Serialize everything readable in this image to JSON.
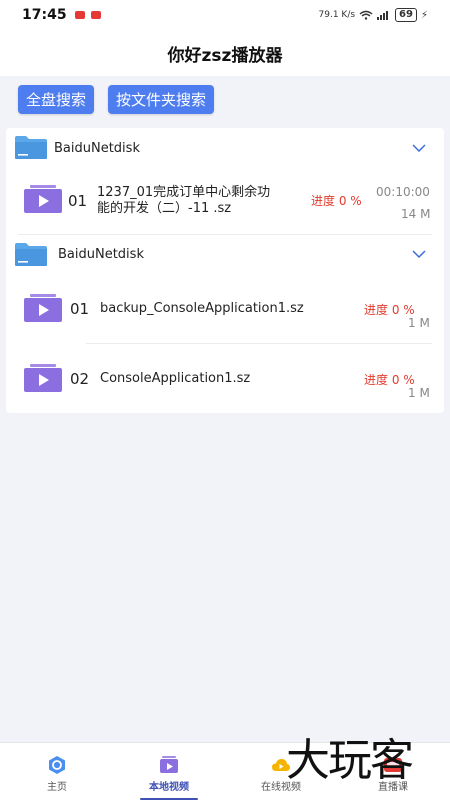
{
  "status_bar": {
    "time": "17:45",
    "network_speed": "79.1 K/s",
    "battery": "69"
  },
  "header": {
    "title": "你好zsz播放器"
  },
  "actions": {
    "search_all_label": "全盘搜索",
    "search_by_folder_label": "按文件夹搜索"
  },
  "groups": [
    {
      "name": "BaiduNetdisk",
      "files": [
        {
          "index": "01",
          "name_line1": "1237_01完成订单中心剩余功",
          "name_line2": "能的开发（二）-11 .sz",
          "progress": "进度 0 %",
          "progress_value": 0,
          "duration": "00:10:00",
          "size": "14 M"
        }
      ]
    },
    {
      "name": "BaiduNetdisk",
      "files": [
        {
          "index": "01",
          "name": "backup_ConsoleApplication1.sz",
          "progress": "进度 0 %",
          "progress_value": 0,
          "size": "1 M"
        },
        {
          "index": "02",
          "name": "ConsoleApplication1.sz",
          "progress": "进度 0 %",
          "progress_value": 0,
          "size": "1 M"
        }
      ]
    }
  ],
  "tabs": [
    {
      "label": "主页",
      "icon": "home-icon"
    },
    {
      "label": "本地视频",
      "icon": "local-video-icon",
      "active": true
    },
    {
      "label": "在线视频",
      "icon": "cloud-video-icon"
    },
    {
      "label": "直播课",
      "icon": "live-class-icon"
    }
  ],
  "watermark": {
    "text": "大玩客"
  },
  "colors": {
    "accent": "#4e7df0",
    "progress": "#e23a2e",
    "folder": "#5aa7ea",
    "video": "#8b6fe0",
    "active_tab": "#3f51b5"
  }
}
